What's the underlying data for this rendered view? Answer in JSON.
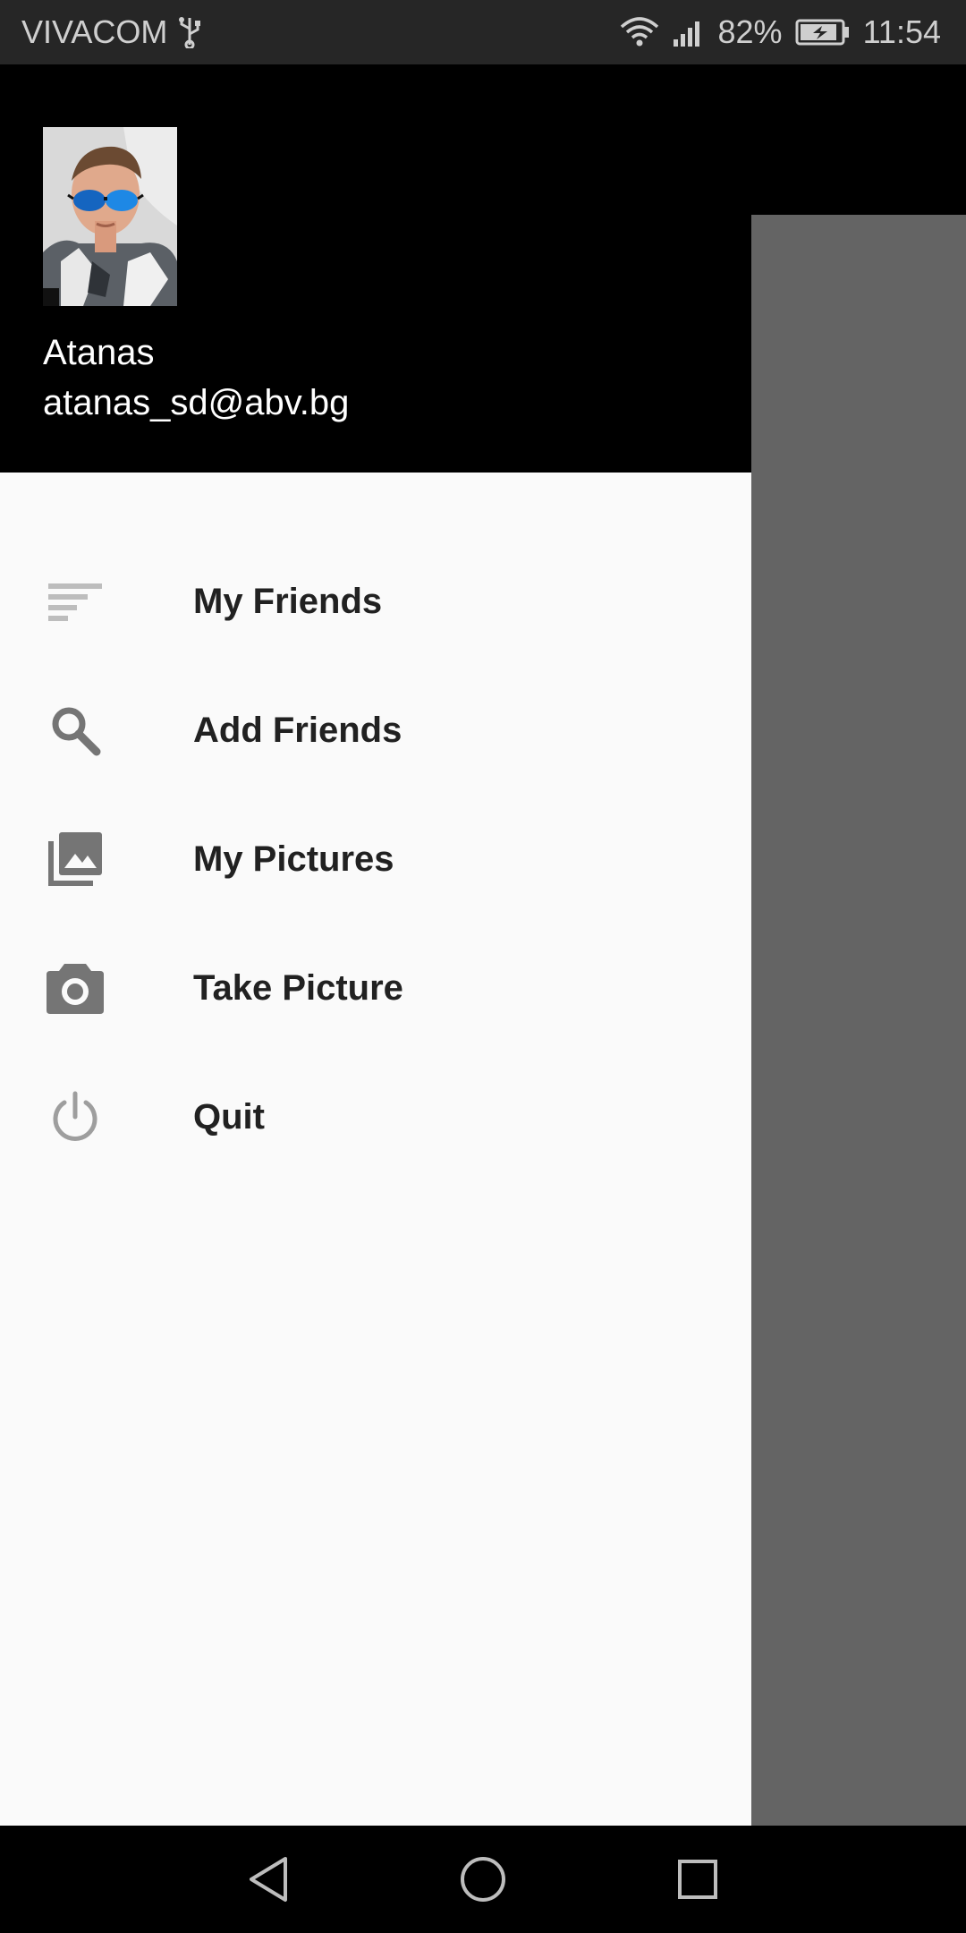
{
  "status_bar": {
    "carrier": "VIVACOM",
    "battery_percent": "82%",
    "time": "11:54",
    "icons": [
      "usb-icon",
      "wifi-icon",
      "signal-icon",
      "battery-charging-icon"
    ]
  },
  "drawer": {
    "user": {
      "name": "Atanas",
      "email": "atanas_sd@abv.bg"
    },
    "menu_items": [
      {
        "label": "My Friends",
        "icon": "sort-list-icon"
      },
      {
        "label": "Add Friends",
        "icon": "search-icon"
      },
      {
        "label": "My Pictures",
        "icon": "photo-library-icon"
      },
      {
        "label": "Take Picture",
        "icon": "camera-icon"
      },
      {
        "label": "Quit",
        "icon": "power-icon"
      }
    ]
  },
  "nav_bar": {
    "buttons": [
      "back-icon",
      "home-icon",
      "recents-icon"
    ]
  },
  "colors": {
    "drawer_bg": "#fafafa",
    "header_bg": "#000000",
    "scrim": "#646464",
    "icon_gray": "#757575",
    "label_text": "#212121"
  }
}
